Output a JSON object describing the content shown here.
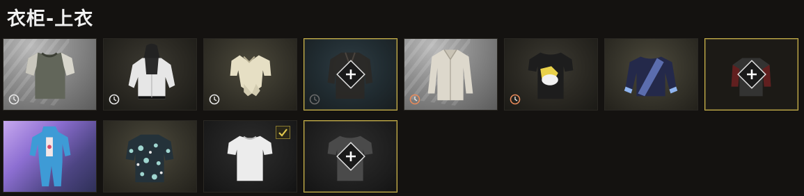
{
  "header": {
    "title": "衣柜-上衣"
  },
  "colors": {
    "accent_gold": "#d9c25a",
    "timer_white": "#e8e8e8",
    "timer_orange": "#e98a5a"
  },
  "slots": [
    {
      "item": "grey-raglan-tshirt",
      "background": "grey",
      "timer": "white",
      "locked": false,
      "selected": false
    },
    {
      "item": "white-hooded-jacket",
      "background": "dark",
      "timer": "white",
      "locked": false,
      "selected": false
    },
    {
      "item": "cream-tied-blouse",
      "background": "olive",
      "timer": "white",
      "locked": false,
      "selected": false
    },
    {
      "item": "dark-leather-jacket",
      "background": "teal",
      "timer": "dim",
      "locked": true,
      "selected": false
    },
    {
      "item": "beige-button-shirt",
      "background": "grey",
      "timer": "orange",
      "locked": false,
      "selected": false
    },
    {
      "item": "black-graphic-tshirt",
      "background": "dark",
      "timer": "orange",
      "locked": false,
      "selected": false
    },
    {
      "item": "navy-sash-sweater",
      "background": "olive",
      "timer": "none",
      "locked": false,
      "selected": false
    },
    {
      "item": "red-sleeve-shirt",
      "background": "empty",
      "timer": "none",
      "locked": true,
      "selected": false
    },
    {
      "item": "blue-onesie",
      "background": "purple",
      "timer": "none",
      "locked": false,
      "selected": false
    },
    {
      "item": "floral-hawaiian-shirt",
      "background": "olive",
      "timer": "none",
      "locked": false,
      "selected": false
    },
    {
      "item": "white-tshirt",
      "background": "black",
      "timer": "none",
      "locked": false,
      "selected": true
    },
    {
      "item": "dark-tshirt",
      "background": "black",
      "timer": "none",
      "locked": true,
      "selected": false
    }
  ]
}
